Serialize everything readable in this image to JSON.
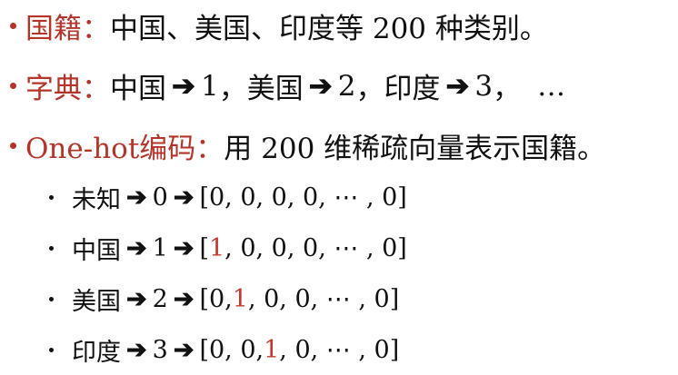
{
  "items": [
    {
      "label": "国籍",
      "colon": "：",
      "text": "中国、美国、印度等 200 种类别。"
    },
    {
      "label": "字典",
      "colon": "：",
      "entries": [
        {
          "name": "中国",
          "value": "1",
          "sep": "，"
        },
        {
          "name": "美国",
          "value": "2",
          "sep": "，"
        },
        {
          "name": "印度",
          "value": "3",
          "sep": "，"
        }
      ],
      "ellipsis": "…"
    },
    {
      "label": "One-hot编码",
      "colon": "：",
      "text": "用 200 维稀疏向量表示国籍。"
    }
  ],
  "arrow_glyph": "➔",
  "encodings": [
    {
      "name": "未知",
      "index": "0",
      "vec_open": "[",
      "pre": "",
      "hl": "",
      "post": "0, 0, 0, 0, ⋯ , 0]"
    },
    {
      "name": "中国",
      "index": "1",
      "vec_open": "[",
      "pre": "",
      "hl": "1",
      "post": ", 0, 0, 0, ⋯ , 0]"
    },
    {
      "name": "美国",
      "index": "2",
      "vec_open": "[",
      "pre": "0, ",
      "hl": "1",
      "post": ", 0, 0, ⋯ , 0]"
    },
    {
      "name": "印度",
      "index": "3",
      "vec_open": "[",
      "pre": "0, 0, ",
      "hl": "1",
      "post": ", 0, ⋯ , 0]"
    }
  ],
  "colors": {
    "accent": "#b5342a",
    "highlight": "#c0392b",
    "text": "#111111"
  }
}
